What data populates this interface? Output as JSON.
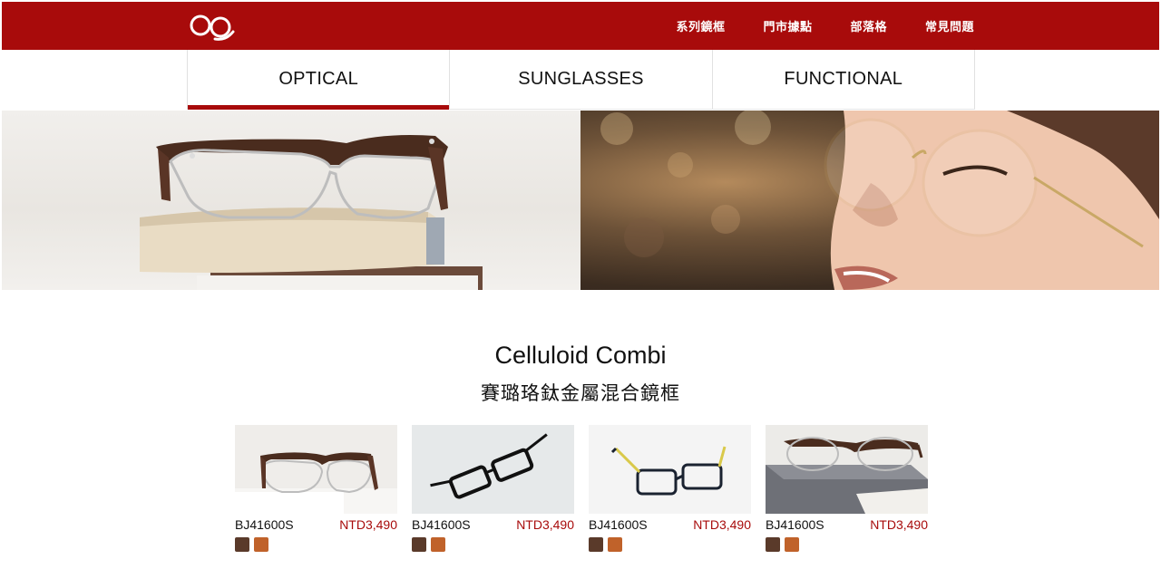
{
  "brand": {
    "logo_icon": "glasses-logo-icon",
    "accent": "#a80b0b"
  },
  "nav": {
    "items": [
      "系列鏡框",
      "門市據點",
      "部落格",
      "常見問題"
    ]
  },
  "tabs": [
    {
      "label": "OPTICAL",
      "active": true
    },
    {
      "label": "SUNGLASSES",
      "active": false
    },
    {
      "label": "FUNCTIONAL",
      "active": false
    }
  ],
  "hero": {
    "left_image": "glasses-on-book",
    "right_image": "woman-wearing-glasses"
  },
  "section": {
    "title": "Celluloid Combi",
    "subtitle": "賽璐珞鈦金屬混合鏡框"
  },
  "products": [
    {
      "sku": "BJ41600S",
      "price": "NTD3,490",
      "swatches": [
        "#5a3a2a",
        "#c0622a"
      ]
    },
    {
      "sku": "BJ41600S",
      "price": "NTD3,490",
      "swatches": [
        "#5a3a2a",
        "#c0622a"
      ]
    },
    {
      "sku": "BJ41600S",
      "price": "NTD3,490",
      "swatches": [
        "#5a3a2a",
        "#c0622a"
      ]
    },
    {
      "sku": "BJ41600S",
      "price": "NTD3,490",
      "swatches": [
        "#5a3a2a",
        "#c0622a"
      ]
    }
  ]
}
